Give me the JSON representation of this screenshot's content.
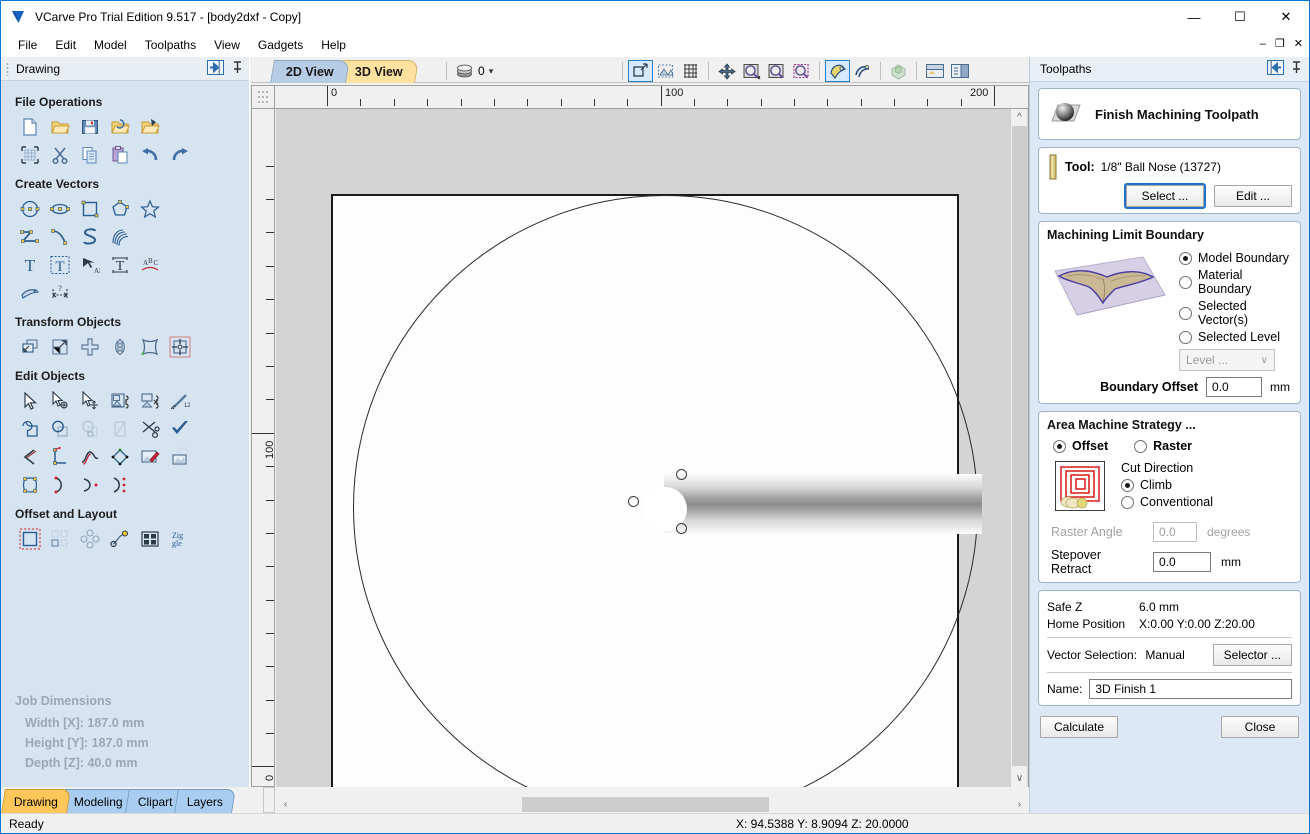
{
  "window": {
    "title": "VCarve Pro Trial Edition 9.517 - [body2dxf - Copy]",
    "logo_icon": "vcarve-logo-icon",
    "minimize": "—",
    "maximize": "☐",
    "close": "✕",
    "mdi_minimize": "–",
    "mdi_restore": "❐",
    "mdi_close": "✕"
  },
  "menu": {
    "items": [
      {
        "label": "File"
      },
      {
        "label": "Edit"
      },
      {
        "label": "Model"
      },
      {
        "label": "Toolpaths"
      },
      {
        "label": "View"
      },
      {
        "label": "Gadgets"
      },
      {
        "label": "Help"
      }
    ]
  },
  "left_panel": {
    "header_title": "Drawing",
    "header_icons": [
      "panel-collapse-icon",
      "pin-icon"
    ],
    "sections": [
      {
        "title": "File Operations",
        "rows": [
          [
            "new-file-icon",
            "open-file-icon",
            "save-file-icon",
            "open-recent-icon",
            "import-vectors-icon"
          ],
          [
            "job-setup-icon",
            "cut-icon",
            "copy-icon",
            "paste-icon",
            "undo-icon",
            "redo-icon"
          ]
        ]
      },
      {
        "title": "Create Vectors",
        "rows": [
          [
            "draw-circle-icon",
            "draw-ellipse-icon",
            "draw-rectangle-icon",
            "draw-polygon-icon",
            "draw-star-icon"
          ],
          [
            "draw-polyline-icon",
            "draw-curve-icon",
            "draw-freehand-icon",
            "draw-spiral-icon"
          ],
          [
            "create-text-icon",
            "edit-text-icon",
            "text-on-curve-icon",
            "auto-layout-text-icon",
            "text-arc-icon"
          ],
          [
            "draw-trace-bitmap-icon",
            "dimension-icon"
          ]
        ]
      },
      {
        "title": "Transform Objects",
        "rows": [
          [
            "move-object-icon",
            "scale-object-icon",
            "align-objects-icon",
            "mirror-object-icon",
            "distort-object-icon",
            "rotate-object-icon"
          ]
        ]
      },
      {
        "title": "Edit Objects",
        "rows": [
          [
            "select-tool-icon",
            "node-edit-icon",
            "move-nodes-icon",
            "group-objects-icon",
            "ungroup-objects-icon",
            "measure-icon"
          ],
          [
            "weld-vectors-icon",
            "subtract-vectors-icon",
            "intersect-vectors-icon",
            "fillet-vectors-icon",
            "trim-vectors-icon",
            "check-geometry-icon"
          ],
          [
            "join-vectors-icon",
            "create-fillet-icon",
            "fit-curve-icon",
            "offset-vectors-icon",
            "edit-bitmap-icon",
            "crop-bitmap-icon"
          ],
          [
            "nest-vectors-icon",
            "curve-start-icon",
            "curve-join-icon",
            "curve-split-icon"
          ]
        ]
      },
      {
        "title": "Offset and Layout",
        "rows": [
          [
            "offset-layout-icon",
            "array-copy-icon",
            "rotate-copy-icon",
            "copy-along-curve-icon",
            "block-copy-icon",
            "nesting-icon"
          ]
        ]
      }
    ],
    "job_dimensions": {
      "title": "Job Dimensions",
      "width": "Width  [X]: 187.0 mm",
      "height": "Height [Y]: 187.0 mm",
      "depth": "Depth  [Z]: 40.0 mm"
    },
    "tabs": [
      {
        "label": "Drawing",
        "active": true
      },
      {
        "label": "Modeling",
        "active": false
      },
      {
        "label": "Clipart",
        "active": false
      },
      {
        "label": "Layers",
        "active": false
      }
    ]
  },
  "center": {
    "view_tabs": [
      {
        "label": "2D View",
        "active": true
      },
      {
        "label": "3D View",
        "active": false
      }
    ],
    "level_selector": {
      "icon": "layers-icon",
      "value": "0",
      "chevron": "▾"
    },
    "toolbar_icons": [
      "zoom-to-selection-icon",
      "zoom-to-drawing-icon",
      "toggle-grid-icon",
      "pan-view-icon",
      "zoom-box-icon",
      "zoom-extents-icon",
      "zoom-selected-icon",
      "toggle-vectors-icon",
      "toggle-toolpaths-icon",
      "toggle-3d-preview-icon",
      "split-view-horizontal-icon",
      "split-view-vertical-icon"
    ],
    "ruler_h": {
      "labels": [
        "0",
        "100",
        "200"
      ],
      "unit": "mm"
    },
    "ruler_v": {
      "labels": [
        "100",
        "0"
      ],
      "unit": "mm"
    }
  },
  "toolpaths_panel": {
    "header_title": "Toolpaths",
    "header_icons": [
      "panel-collapse-icon",
      "pin-icon"
    ],
    "toolpath_title": "Finish Machining Toolpath",
    "toolpath_icon": "finish-toolpath-icon",
    "tool": {
      "icon": "tool-bit-icon",
      "label": "Tool:",
      "value": "1/8\" Ball Nose (13727)",
      "select_button": "Select ...",
      "edit_button": "Edit ..."
    },
    "machining_limit_boundary": {
      "title": "Machining Limit Boundary",
      "preview_icon": "eagle-relief-preview-icon",
      "options": [
        {
          "label": "Model Boundary",
          "selected": true
        },
        {
          "label": "Material Boundary",
          "selected": false
        },
        {
          "label": "Selected Vector(s)",
          "selected": false
        },
        {
          "label": "Selected Level",
          "selected": false
        }
      ],
      "level_select": {
        "value": "Level ...",
        "enabled": false,
        "chevron": "∨"
      },
      "boundary_offset_label": "Boundary Offset",
      "boundary_offset_value": "0.0",
      "boundary_offset_unit": "mm"
    },
    "area_machine_strategy": {
      "title": "Area Machine Strategy ...",
      "strategies": [
        {
          "label": "Offset",
          "selected": true
        },
        {
          "label": "Raster",
          "selected": false
        }
      ],
      "preview_icon": "offset-strategy-preview-icon",
      "cut_direction_label": "Cut Direction",
      "cut_directions": [
        {
          "label": "Climb",
          "selected": true
        },
        {
          "label": "Conventional",
          "selected": false
        }
      ],
      "raster_angle_label": "Raster Angle",
      "raster_angle_value": "0.0",
      "raster_angle_unit": "degrees",
      "raster_angle_enabled": false,
      "stepover_retract_label": "Stepover Retract",
      "stepover_retract_value": "0.0",
      "stepover_retract_unit": "mm"
    },
    "settings": {
      "safe_z_label": "Safe Z",
      "safe_z_value": "6.0 mm",
      "home_position_label": "Home Position",
      "home_position_value": "X:0.00 Y:0.00 Z:20.00",
      "vector_selection_label": "Vector Selection:",
      "vector_selection_value": "Manual",
      "selector_button": "Selector ...",
      "name_label": "Name:",
      "name_value": "3D Finish 1"
    },
    "calculate_button": "Calculate",
    "close_button": "Close"
  },
  "statusbar": {
    "ready": "Ready",
    "coords": "X: 94.5388 Y:  8.9094 Z: 20.0000"
  },
  "colors": {
    "accent": "#0078d7",
    "panel_bg": "#d6e3f0",
    "right_panel_bg": "#dce8f5",
    "active_tab": "#ffc75a",
    "focus_border": "#1d74c8"
  }
}
